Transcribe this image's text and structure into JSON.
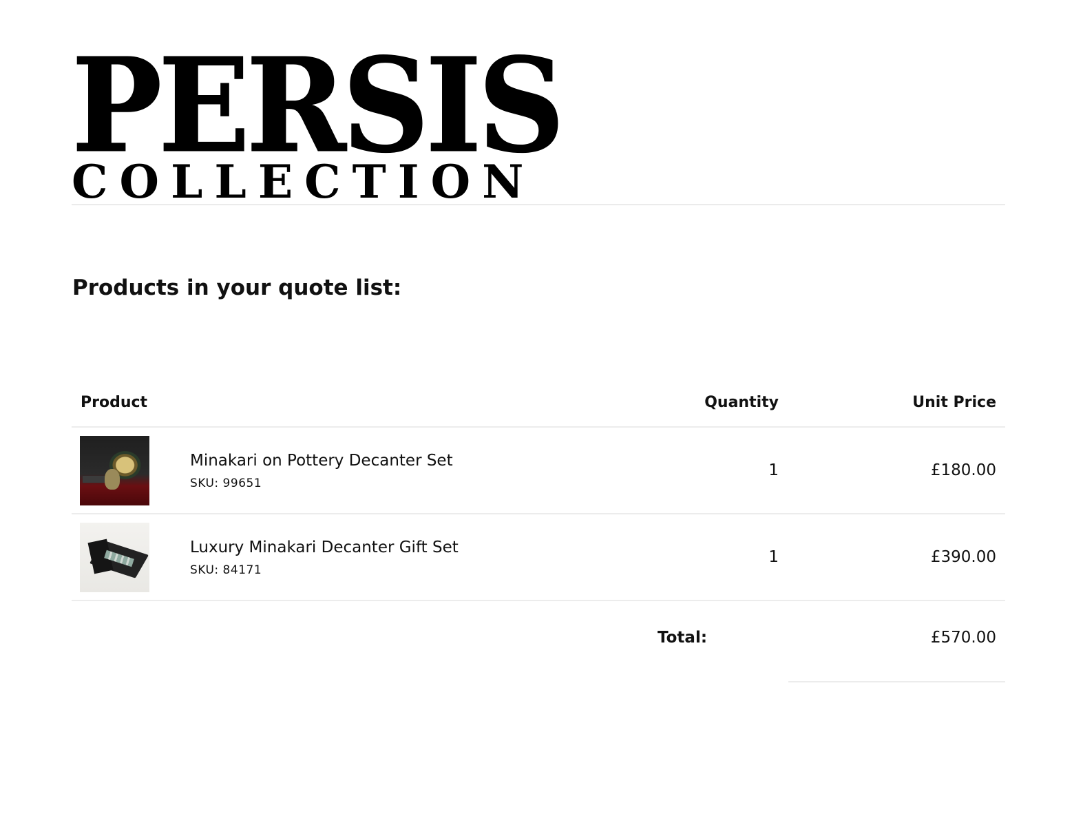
{
  "brand": {
    "logo_main": "PERSIS",
    "logo_sub": "COLLECTION"
  },
  "heading": "Products in your quote list:",
  "table": {
    "headers": {
      "product": "Product",
      "quantity": "Quantity",
      "unit_price": "Unit Price"
    },
    "rows": [
      {
        "name": "Minakari on Pottery Decanter Set",
        "sku": "SKU: 99651",
        "quantity": "1",
        "unit_price": "£180.00"
      },
      {
        "name": "Luxury Minakari Decanter Gift Set",
        "sku": "SKU: 84171",
        "quantity": "1",
        "unit_price": "£390.00"
      }
    ]
  },
  "total": {
    "label": "Total:",
    "value": "£570.00"
  }
}
